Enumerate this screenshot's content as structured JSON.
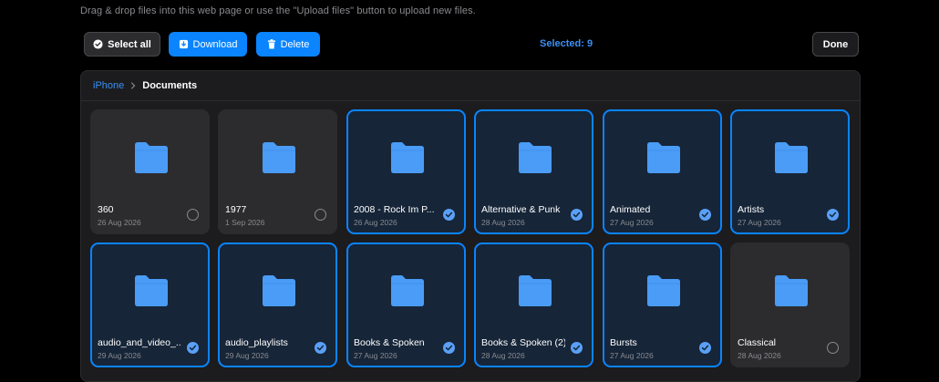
{
  "hint": "Drag & drop files into this web page or use the \"Upload files\" button to upload new files.",
  "toolbar": {
    "select_all": "Select all",
    "download": "Download",
    "delete": "Delete",
    "selected": "Selected: 9",
    "done": "Done"
  },
  "breadcrumb": {
    "root": "iPhone",
    "current": "Documents"
  },
  "colors": {
    "accent": "#0a84ff",
    "tile": "#2c2c2e",
    "tile_selected": "#162538",
    "folder": "#4a9cf7"
  },
  "icons": {
    "select_all": "check-circle-icon",
    "download": "download-icon",
    "delete": "trash-icon",
    "breadcrumb_sep": "chevron-right-icon",
    "folder": "folder-icon"
  },
  "folders": [
    {
      "name": "360",
      "date": "26 Aug 2026",
      "selected": false
    },
    {
      "name": "1977",
      "date": "1 Sep 2026",
      "selected": false
    },
    {
      "name": "2008 - Rock Im P...",
      "date": "26 Aug 2026",
      "selected": true
    },
    {
      "name": "Alternative & Punk",
      "date": "28 Aug 2026",
      "selected": true
    },
    {
      "name": "Animated",
      "date": "27 Aug 2026",
      "selected": true
    },
    {
      "name": "Artists",
      "date": "27 Aug 2026",
      "selected": true
    },
    {
      "name": "audio_and_video_...",
      "date": "29 Aug 2026",
      "selected": true
    },
    {
      "name": "audio_playlists",
      "date": "29 Aug 2026",
      "selected": true
    },
    {
      "name": "Books & Spoken",
      "date": "27 Aug 2026",
      "selected": true
    },
    {
      "name": "Books & Spoken (2)",
      "date": "28 Aug 2026",
      "selected": true
    },
    {
      "name": "Bursts",
      "date": "27 Aug 2026",
      "selected": true
    },
    {
      "name": "Classical",
      "date": "28 Aug 2026",
      "selected": false
    }
  ]
}
